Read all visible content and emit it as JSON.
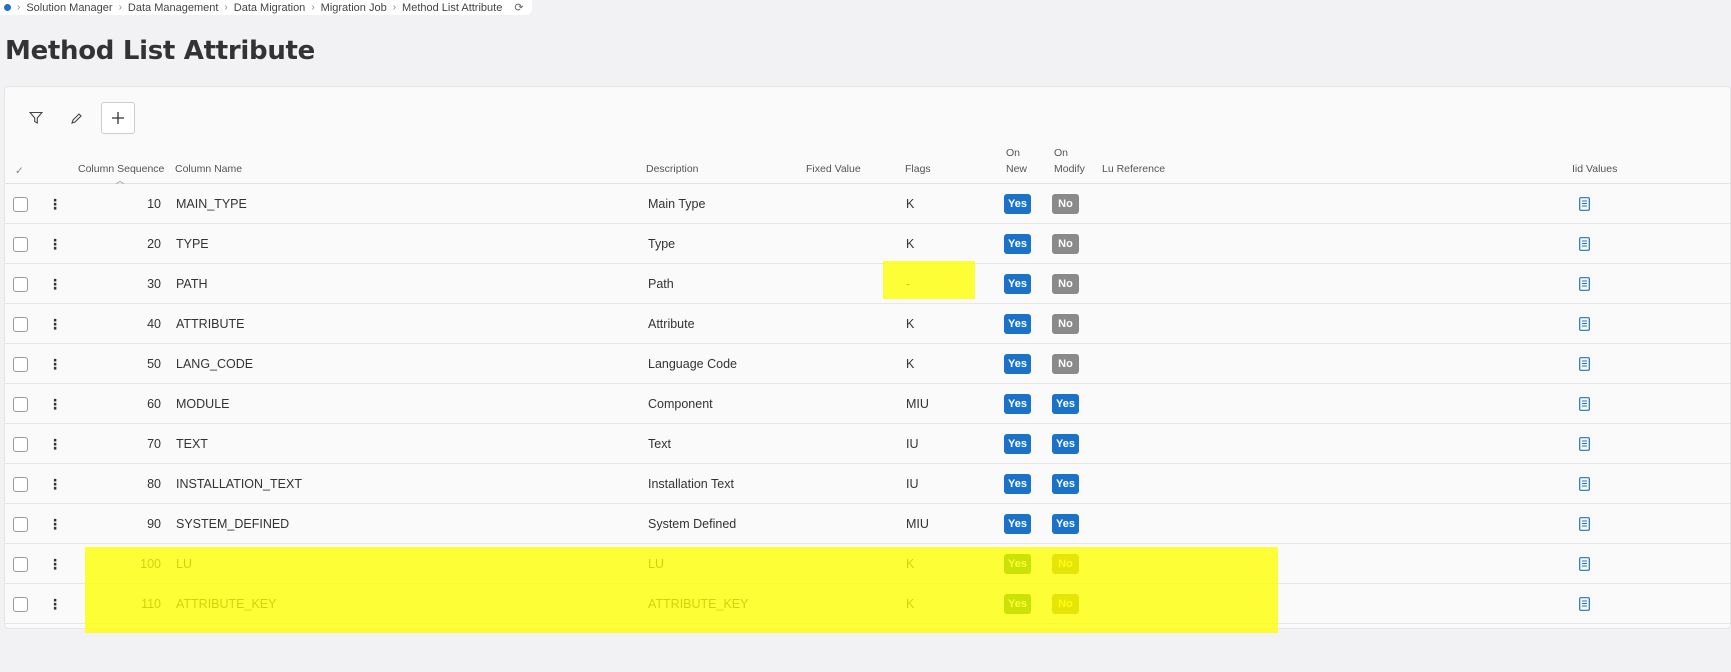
{
  "breadcrumb": {
    "items": [
      "Solution Manager",
      "Data Management",
      "Data Migration",
      "Migration Job",
      "Method List Attribute"
    ]
  },
  "page": {
    "title": "Method List Attribute"
  },
  "toolbar": {
    "filter_icon": "filter-icon",
    "edit_icon": "pencil-icon",
    "add_icon": "plus-icon"
  },
  "table": {
    "headers": {
      "select": "✓",
      "column_sequence": "Column Sequence",
      "column_name": "Column Name",
      "description": "Description",
      "fixed_value": "Fixed Value",
      "flags": "Flags",
      "on_new_1": "On",
      "on_new_2": "New",
      "on_modify_1": "On",
      "on_modify_2": "Modify",
      "lu_reference": "Lu Reference",
      "iid_values": "Iid Values"
    },
    "rows": [
      {
        "seq": "10",
        "name": "MAIN_TYPE",
        "description": "Main Type",
        "flags": "K",
        "on_new": "Yes",
        "on_modify": "No"
      },
      {
        "seq": "20",
        "name": "TYPE",
        "description": "Type",
        "flags": "K",
        "on_new": "Yes",
        "on_modify": "No"
      },
      {
        "seq": "30",
        "name": "PATH",
        "description": "Path",
        "flags": "-",
        "on_new": "Yes",
        "on_modify": "No"
      },
      {
        "seq": "40",
        "name": "ATTRIBUTE",
        "description": "Attribute",
        "flags": "K",
        "on_new": "Yes",
        "on_modify": "No"
      },
      {
        "seq": "50",
        "name": "LANG_CODE",
        "description": "Language Code",
        "flags": "K",
        "on_new": "Yes",
        "on_modify": "No"
      },
      {
        "seq": "60",
        "name": "MODULE",
        "description": "Component",
        "flags": "MIU",
        "on_new": "Yes",
        "on_modify": "Yes"
      },
      {
        "seq": "70",
        "name": "TEXT",
        "description": "Text",
        "flags": "IU",
        "on_new": "Yes",
        "on_modify": "Yes"
      },
      {
        "seq": "80",
        "name": "INSTALLATION_TEXT",
        "description": "Installation Text",
        "flags": "IU",
        "on_new": "Yes",
        "on_modify": "Yes"
      },
      {
        "seq": "90",
        "name": "SYSTEM_DEFINED",
        "description": "System Defined",
        "flags": "MIU",
        "on_new": "Yes",
        "on_modify": "Yes"
      },
      {
        "seq": "100",
        "name": "LU",
        "description": "LU",
        "flags": "K",
        "on_new": "Yes",
        "on_modify": "No"
      },
      {
        "seq": "110",
        "name": "ATTRIBUTE_KEY",
        "description": "ATTRIBUTE_KEY",
        "flags": "K",
        "on_new": "Yes",
        "on_modify": "No"
      }
    ]
  },
  "colors": {
    "accent": "#1a73c8",
    "highlight": "#ffff00",
    "yes_highlighted": "#117a1a",
    "no_badge": "#8a8a8a"
  }
}
